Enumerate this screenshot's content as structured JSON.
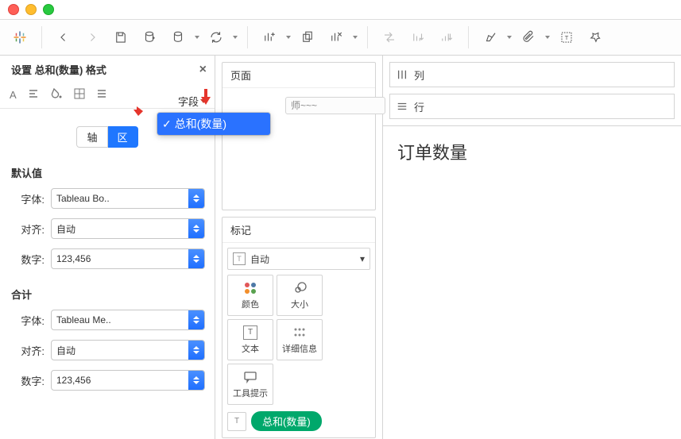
{
  "format_pane": {
    "title": "设置 总和(数量) 格式",
    "field_label": "字段",
    "dropdown_item": "总和(数量)",
    "tabs": {
      "axis": "轴",
      "area": "区"
    },
    "sections": {
      "default": {
        "title": "默认值",
        "font_label": "字体:",
        "font_value": "Tableau Bo..",
        "align_label": "对齐:",
        "align_value": "自动",
        "number_label": "数字:",
        "number_value": "123,456"
      },
      "total": {
        "title": "合计",
        "font_label": "字体:",
        "font_value": "Tableau Me..",
        "align_label": "对齐:",
        "align_value": "自动",
        "number_label": "数字:",
        "number_value": "123,456"
      }
    }
  },
  "shelves": {
    "pages_title": "页面",
    "marks_title": "标记",
    "marks_type_text": "自动",
    "marks_cells": {
      "color": "颜色",
      "size": "大小",
      "text": "文本",
      "detail": "详细信息",
      "tooltip": "工具提示"
    },
    "pill_label": "总和(数量)",
    "truncated_card": "师~~~"
  },
  "cols_rows": {
    "columns_label": "列",
    "rows_label": "行"
  },
  "viz": {
    "title": "订单数量"
  }
}
